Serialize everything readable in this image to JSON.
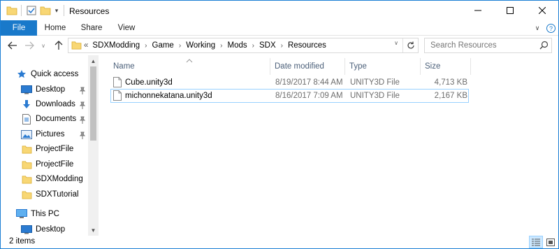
{
  "window": {
    "title": "Resources"
  },
  "ribbon": {
    "tabs": [
      "File",
      "Home",
      "Share",
      "View"
    ]
  },
  "address": {
    "overflow": "«",
    "crumbs": [
      "SDXModding",
      "Game",
      "Working",
      "Mods",
      "SDX",
      "Resources"
    ]
  },
  "search": {
    "placeholder": "Search Resources"
  },
  "navpane": {
    "quick_access": "Quick access",
    "items": [
      {
        "label": "Desktop",
        "icon": "desktop-icon",
        "pinned": true
      },
      {
        "label": "Downloads",
        "icon": "downloads-icon",
        "pinned": true
      },
      {
        "label": "Documents",
        "icon": "documents-icon",
        "pinned": true
      },
      {
        "label": "Pictures",
        "icon": "pictures-icon",
        "pinned": true
      },
      {
        "label": "ProjectFile",
        "icon": "folder-icon",
        "pinned": false
      },
      {
        "label": "ProjectFile",
        "icon": "folder-icon",
        "pinned": false
      },
      {
        "label": "SDXModding",
        "icon": "folder-icon",
        "pinned": false
      },
      {
        "label": "SDXTutorial",
        "icon": "folder-icon",
        "pinned": false
      }
    ],
    "this_pc": "This PC",
    "this_pc_items": [
      {
        "label": "Desktop",
        "icon": "desktop-icon"
      }
    ]
  },
  "columns": [
    "Name",
    "Date modified",
    "Type",
    "Size"
  ],
  "files": [
    {
      "name": "Cube.unity3d",
      "date": "8/19/2017 8:44 AM",
      "type": "UNITY3D File",
      "size": "4,713 KB",
      "selected": false
    },
    {
      "name": "michonnekatana.unity3d",
      "date": "8/16/2017 7:09 AM",
      "type": "UNITY3D File",
      "size": "2,167 KB",
      "selected": true
    }
  ],
  "status": {
    "item_count": "2 items"
  },
  "colors": {
    "accent": "#1979ca",
    "selection_border": "#99d1ff",
    "folder": "#f8d775",
    "header_text": "#4c607a"
  }
}
